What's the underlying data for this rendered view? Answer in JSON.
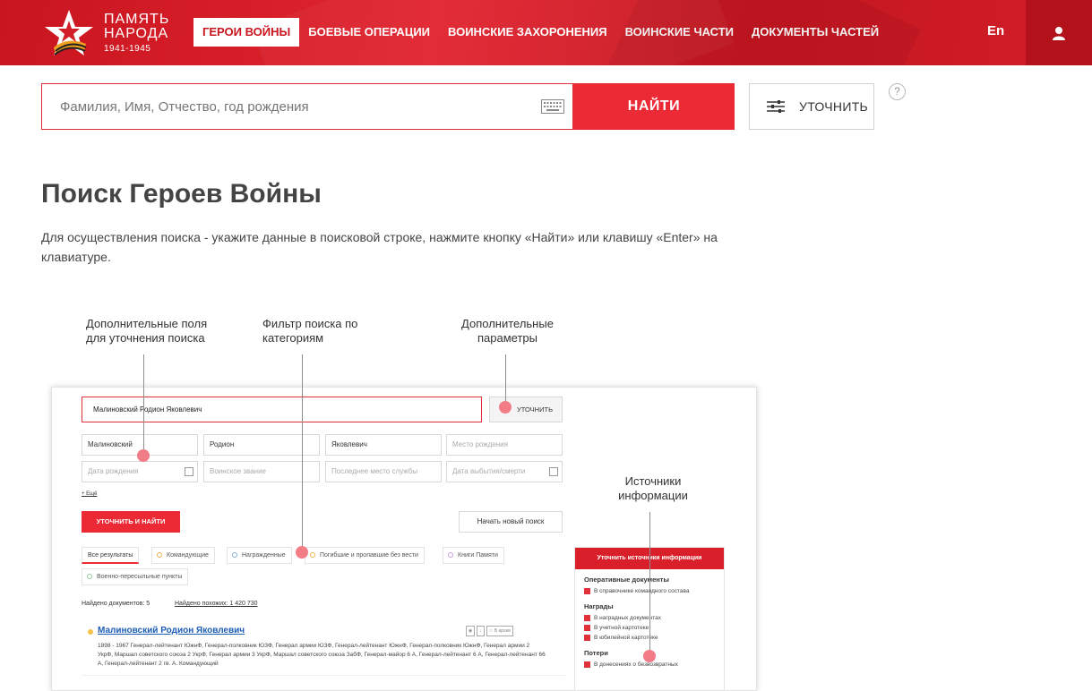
{
  "header": {
    "logo": {
      "line1": "ПАМЯТЬ",
      "line2": "НАРОДА",
      "years": "1941-1945"
    },
    "nav": [
      {
        "label": "ГЕРОИ ВОЙНЫ",
        "active": true
      },
      {
        "label": "БОЕВЫЕ ОПЕРАЦИИ"
      },
      {
        "label": "ВОИНСКИЕ ЗАХОРОНЕНИЯ"
      },
      {
        "label": "ВОИНСКИЕ ЧАСТИ"
      },
      {
        "label": "ДОКУМЕНТЫ ЧАСТЕЙ"
      }
    ],
    "lang": "En",
    "user_icon": "user-icon",
    "colors": {
      "brand": "#d21e28",
      "accent": "#ec2a36"
    }
  },
  "search": {
    "placeholder": "Фамилия, Имя, Отчество, год рождения",
    "value": "",
    "keyboard_icon": "keyboard-icon",
    "find_label": "НАЙТИ",
    "refine_label": "УТОЧНИТЬ",
    "refine_icon": "sliders-icon",
    "help_label": "?"
  },
  "main": {
    "title": "Поиск Героев Войны",
    "description": "Для осуществления поиска - укажите данные в поисковой строке, нажмите кнопку «Найти» или клавишу «Enter» на клавиатуре."
  },
  "illustration": {
    "annotations": {
      "fields": "Дополнительные поля для уточнения поиска",
      "filter": "Фильтр поиска по категориям",
      "params": "Дополнительные параметры",
      "sources": "Источники информации"
    },
    "query": "Малиновский Родион Яковлевич",
    "refine_label": "УТОЧНИТЬ",
    "fields": {
      "surname": "Малиновский",
      "name": "Родион",
      "patronymic": "Яковлевич",
      "birth_place": "Место рождения",
      "birth_date": "Дата рождения",
      "rank": "Воинское звание",
      "last_service": "Последнее место службы",
      "leave_date": "Дата выбытия/смерти"
    },
    "more_link": "+ Ещё",
    "refine_find_label": "УТОЧНИТЬ И НАЙТИ",
    "new_search_label": "Начать новый поиск",
    "tabs": [
      "Все результаты",
      "Командующие",
      "Награжденные",
      "Погибшие и пропавшие без вести",
      "Книги Памяти",
      "Военно-пересыльные пункты"
    ],
    "found_label": "Найдено документов: 5",
    "similar_label": "Найдено похожих: 1 420 730",
    "result": {
      "name": "Малиновский Родион Яковлевич",
      "text": "1898 - 1967 Генерал-лейтенант ЮжнФ, Генерал-полковник ЮЗФ, Генерал армии ЮЗФ, Генерал-лейтенант ЮжнФ, Генерал-полковник ЮжнФ, Генерал армии 2 УкрФ, Маршал советского союза 2 УкрФ, Генерал армии 3 УкрФ, Маршал советского союза ЗабФ, Генерал-майор 6 А, Генерал-лейтенант 6 А, Генерал-лейтенант 66 А, Генерал-лейтенант 2 гв. А. Командующий",
      "archive_label": "☆ В архив"
    },
    "panel": {
      "title": "Уточнить источники информации",
      "sections": [
        {
          "title": "Оперативные документы",
          "items": [
            "В справочнике командного состава"
          ]
        },
        {
          "title": "Награды",
          "items": [
            "В наградных документах",
            "В учетной картотеке",
            "В юбилейной картотеке"
          ]
        },
        {
          "title": "Потери",
          "items": [
            "В донесениях о безвозвратных"
          ]
        }
      ]
    }
  }
}
